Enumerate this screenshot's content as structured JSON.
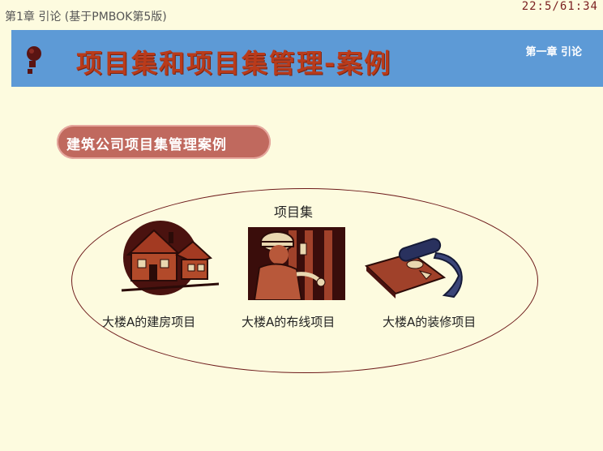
{
  "header": {
    "chapter_crumb": "第1章 引论 (基于PMBOK第5版)",
    "timer": "22:5/61:34"
  },
  "banner": {
    "title": "项目集和项目集管理-案例",
    "subtitle": "第一章 引论",
    "color": "#5d9ad6",
    "title_color": "#b93b1b"
  },
  "section_pill": {
    "label": "建筑公司项目集管理案例",
    "color": "#c0695e"
  },
  "program": {
    "label": "项目集",
    "projects": [
      {
        "label": "大楼A的建房项目",
        "icon": "house-icon"
      },
      {
        "label": "大楼A的布线项目",
        "icon": "electrician-icon"
      },
      {
        "label": "大楼A的装修项目",
        "icon": "carpet-roll-icon"
      }
    ]
  }
}
